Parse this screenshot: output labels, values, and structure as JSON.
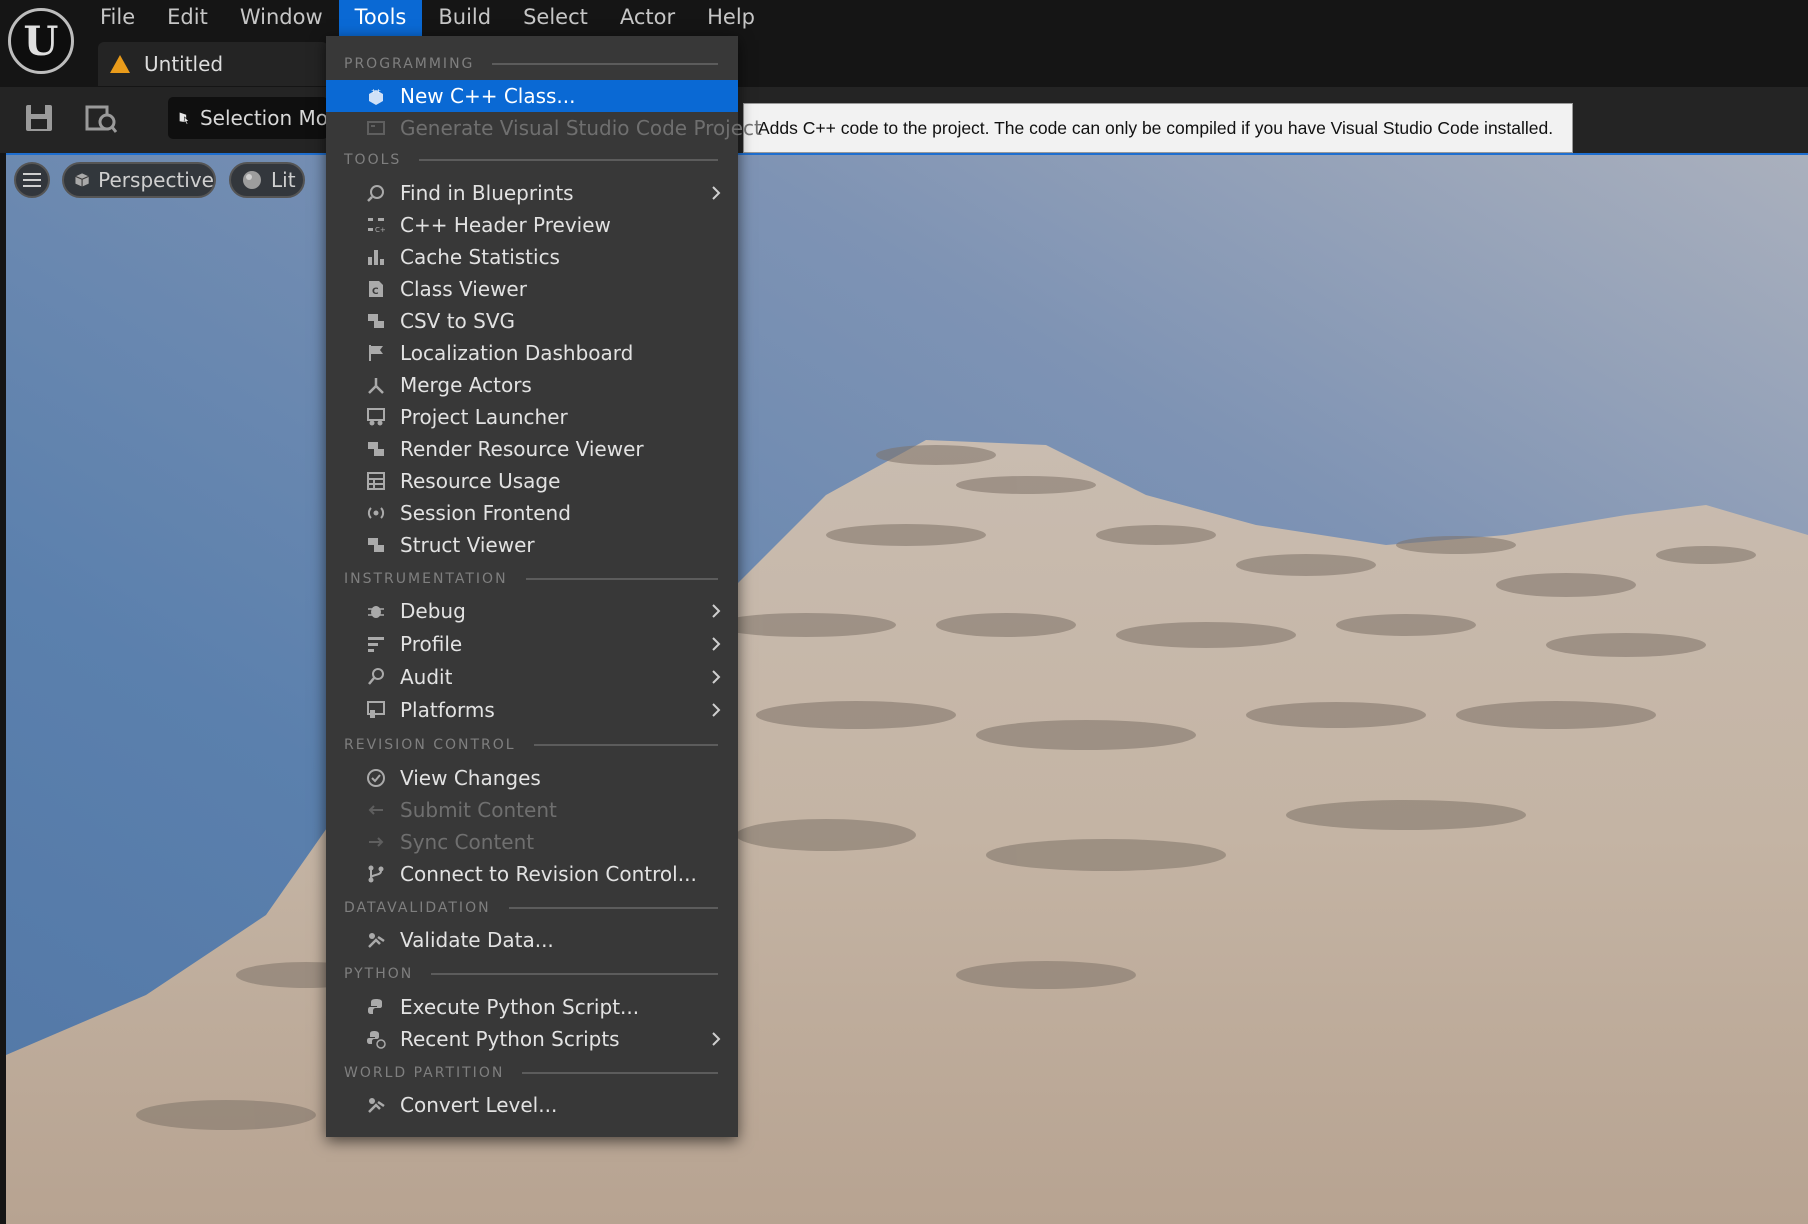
{
  "menubar": {
    "items": [
      "File",
      "Edit",
      "Window",
      "Tools",
      "Build",
      "Select",
      "Actor",
      "Help"
    ],
    "active": "Tools"
  },
  "document_tab": {
    "title": "Untitled"
  },
  "toolbar": {
    "selection_mode_label": "Selection Mo"
  },
  "viewport": {
    "perspective_label": "Perspective",
    "lit_label": "Lit"
  },
  "tooltip": {
    "text": "Adds C++ code to the project. The code can only be compiled if you have Visual Studio Code installed."
  },
  "tools_menu": {
    "sections": {
      "programming": "PROGRAMMING",
      "tools": "TOOLS",
      "instrumentation": "INSTRUMENTATION",
      "revision_control": "REVISION CONTROL",
      "datavalidation": "DATAVALIDATION",
      "python": "PYTHON",
      "world_partition": "WORLD PARTITION"
    },
    "items": {
      "new_cpp_class": "New C++ Class...",
      "generate_vscode": "Generate Visual Studio Code Project",
      "find_in_blueprints": "Find in Blueprints",
      "cpp_header_preview": "C++ Header Preview",
      "cache_statistics": "Cache Statistics",
      "class_viewer": "Class Viewer",
      "csv_to_svg": "CSV to SVG",
      "localization_dashboard": "Localization Dashboard",
      "merge_actors": "Merge Actors",
      "project_launcher": "Project Launcher",
      "render_resource_viewer": "Render Resource Viewer",
      "resource_usage": "Resource Usage",
      "session_frontend": "Session Frontend",
      "struct_viewer": "Struct Viewer",
      "debug": "Debug",
      "profile": "Profile",
      "audit": "Audit",
      "platforms": "Platforms",
      "view_changes": "View Changes",
      "submit_content": "Submit Content",
      "sync_content": "Sync Content",
      "connect_revision_control": "Connect to Revision Control...",
      "validate_data": "Validate Data...",
      "execute_python_script": "Execute Python Script...",
      "recent_python_scripts": "Recent Python Scripts",
      "convert_level": "Convert Level..."
    }
  },
  "colors": {
    "accent": "#0a69d4",
    "menu_bg": "#383838",
    "warning": "#e99b1a"
  }
}
